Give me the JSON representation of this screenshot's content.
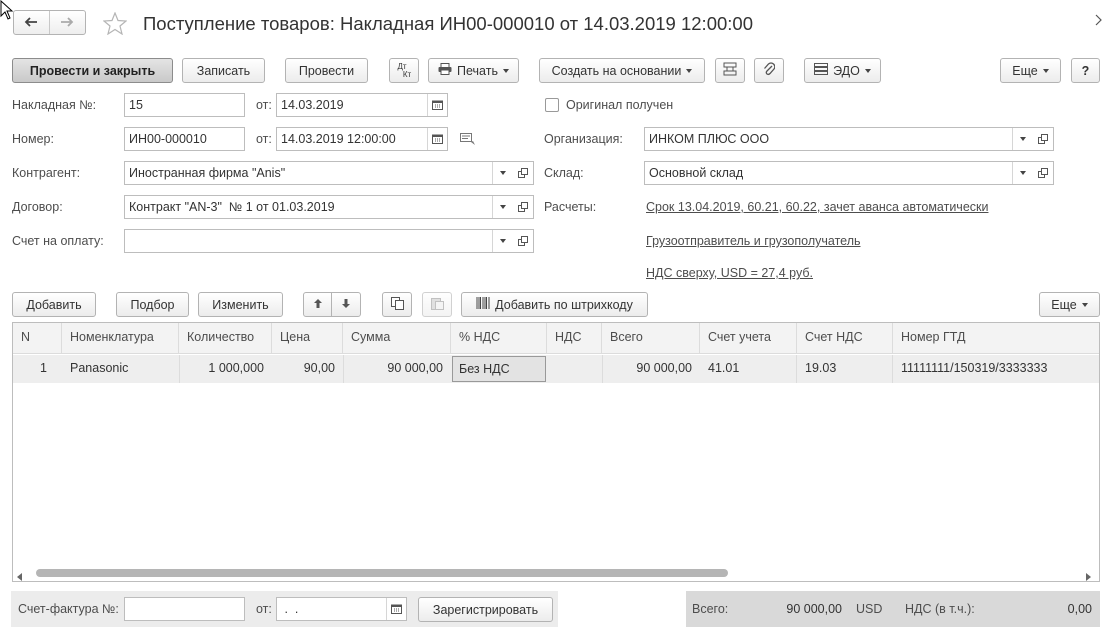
{
  "title": "Поступление товаров: Накладная ИН00-000010 от 14.03.2019 12:00:00",
  "toolbar": {
    "post_close": "Провести и закрыть",
    "save": "Записать",
    "post": "Провести",
    "dt_kt_top": "Дт",
    "dt_kt_bottom": "Кт",
    "print": "Печать",
    "create_based": "Создать на основании",
    "edo": "ЭДО",
    "more": "Еще",
    "help": "?"
  },
  "form": {
    "invoice_no_label": "Накладная №:",
    "invoice_no_value": "15",
    "from_label": "от:",
    "invoice_date": "14.03.2019",
    "original_label": "Оригинал получен",
    "number_label": "Номер:",
    "number_value": "ИН00-000010",
    "number_date": "14.03.2019 12:00:00",
    "org_label": "Организация:",
    "org_value": "ИНКОМ ПЛЮС ООО",
    "contractor_label": "Контрагент:",
    "contractor_value": "Иностранная фирма \"Anis\"",
    "warehouse_label": "Склад:",
    "warehouse_value": "Основной склад",
    "contract_label": "Договор:",
    "contract_value": "Контракт \"AN-3\"  № 1 от 01.03.2019",
    "settlements_label": "Расчеты:",
    "settlements_link": "Срок 13.04.2019, 60.21, 60.22, зачет аванса автоматически",
    "payment_invoice_label": "Счет на оплату:",
    "payment_invoice_value": "",
    "shipper_link": "Грузоотправитель и грузополучатель",
    "vat_link": "НДС сверху, USD = 27,4 руб."
  },
  "table_toolbar": {
    "add": "Добавить",
    "pick": "Подбор",
    "edit": "Изменить",
    "barcode": "Добавить по штрихкоду",
    "more": "Еще"
  },
  "table": {
    "columns": [
      "N",
      "Номенклатура",
      "Количество",
      "Цена",
      "Сумма",
      "% НДС",
      "НДС",
      "Всего",
      "Счет учета",
      "Счет НДС",
      "Номер ГТД"
    ],
    "rows": [
      [
        "1",
        "Panasonic",
        "1 000,000",
        "90,00",
        "90 000,00",
        "Без НДС",
        "",
        "90 000,00",
        "41.01",
        "19.03",
        "11111111/150319/3333333"
      ]
    ]
  },
  "footer": {
    "sf_label": "Счет-фактура №:",
    "sf_value": "",
    "sf_from_label": "от:",
    "sf_date": " .  .",
    "register": "Зарегистрировать",
    "total_label": "Всего:",
    "total_value": "90 000,00",
    "currency": "USD",
    "vat_label": "НДС (в т.ч.):",
    "vat_value": "0,00"
  }
}
